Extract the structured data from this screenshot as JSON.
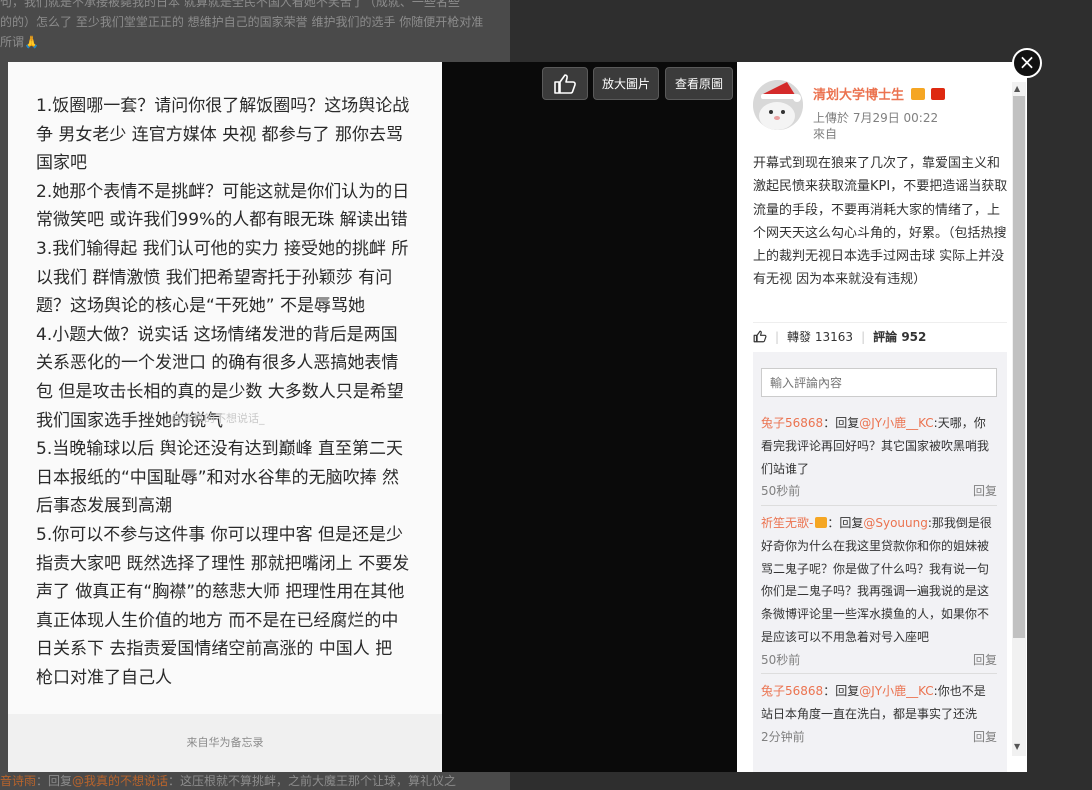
{
  "background": {
    "line1": "句，我们就是不承接被毙我的日本 就算就是全民不国人看她不笑苦了（成就、一些名些",
    "line2": "的的）怎么了 至少我们堂堂正正的 想维护自己的国家荣誉 维护我们的选手 你随便开枪对准",
    "line3": "所谓🙏",
    "bottom_name": "音诗雨",
    "bottom_reply": "：回复",
    "bottom_mention": "@我真的不想说话",
    "bottom_text": "：这压根就不算挑衅，之前大魔王那个让球，算礼仪之"
  },
  "toolbar": {
    "zoom_label": "放大圖片",
    "original_label": "查看原圖",
    "close_symbol": "×"
  },
  "image": {
    "lines": [
      "1.饭圈哪一套？请问你很了解饭圈吗？这场舆论战",
      "争 男女老少 连官方媒体 央视 都参与了 那你去骂",
      "国家吧",
      "2.她那个表情不是挑衅？可能这就是你们认为的日",
      "常微笑吧  或许我们99%的人都有眼无珠 解读出错",
      "3.我们输得起 我们认可他的实力 接受她的挑衅 所",
      "以我们 群情激愤 我们把希望寄托于孙颖莎 有问",
      "题？这场舆论的核心是“干死她” 不是辱骂她",
      "4.小题大做？说实话 这场情绪发泄的背后是两国",
      "关系恶化的一个发泄口  的确有很多人恶搞她表情",
      "包 但是攻击长相的真的是少数 大多数人只是希望",
      "我们国家选手挫她的锐气",
      "5.当晚输球以后 舆论还没有达到巅峰 直至第二天",
      "日本报纸的“中国耻辱”和对水谷隼的无脑吹捧 然",
      "后事态发展到高潮",
      "5.你可以不参与这件事 你可以理中客 但是还是少",
      "指责大家吧 既然选择了理性 那就把嘴闭上 不要发",
      "声了 做真正有“胸襟”的慈悲大师  把理性用在其他",
      "真正体现人生价值的地方  而不是在已经腐烂的中",
      "日关系下 去指责爱国情绪空前高涨的 中国人  把",
      "枪口对准了自己人"
    ],
    "watermark": "@我真的不想说话_",
    "footer": "来自华为备忘录"
  },
  "panel": {
    "username": "清划大学博士生",
    "posted": "上傳於 7月29日 00:22",
    "source": "來自",
    "post_text": "开幕式到现在狼来了几次了，靠爱国主义和激起民愤来获取流量KPI，不要把造谣当获取流量的手段，不要再消耗大家的情绪了，上个网天天这么勾心斗角的，好累。（包括热搜上的裁判无视日本选手过网击球 实际上并没有无视 因为本来就没有违规）",
    "repost_label": "轉發",
    "repost_count": "13163",
    "comment_label": "評論",
    "comment_count": "952",
    "comment_placeholder": "輸入評論內容",
    "comments": [
      {
        "nick": "兔子56868",
        "reply": "：回复",
        "mention": "@JY小鹿__KC",
        "text": ":天哪，你看完我评论再回好吗？其它国家被吹黑哨我们站谁了",
        "time": "50秒前",
        "action": "回复"
      },
      {
        "nick": "祈笙无歌-",
        "reply": "：回复",
        "mention": "@Syouung",
        "text": ":那我倒是很好奇你为什么在我这里贷款你和你的姐妹被骂二鬼子呢？你是做了什么吗？我有说一句你们是二鬼子吗？我再强调一遍我说的是这条微博评论里一些浑水摸鱼的人，如果你不是应该可以不用急着对号入座吧",
        "time": "50秒前",
        "action": "回复"
      },
      {
        "nick": "兔子56868",
        "reply": "：回复",
        "mention": "@JY小鹿__KC",
        "text": ":你也不是站日本角度一直在洗白，都是事实了还洗",
        "time": "2分钟前",
        "action": "回复"
      }
    ]
  },
  "colors": {
    "accent": "#eb7350",
    "viewer_bg": "#0a0a0a",
    "panel_bg": "#ffffff"
  }
}
